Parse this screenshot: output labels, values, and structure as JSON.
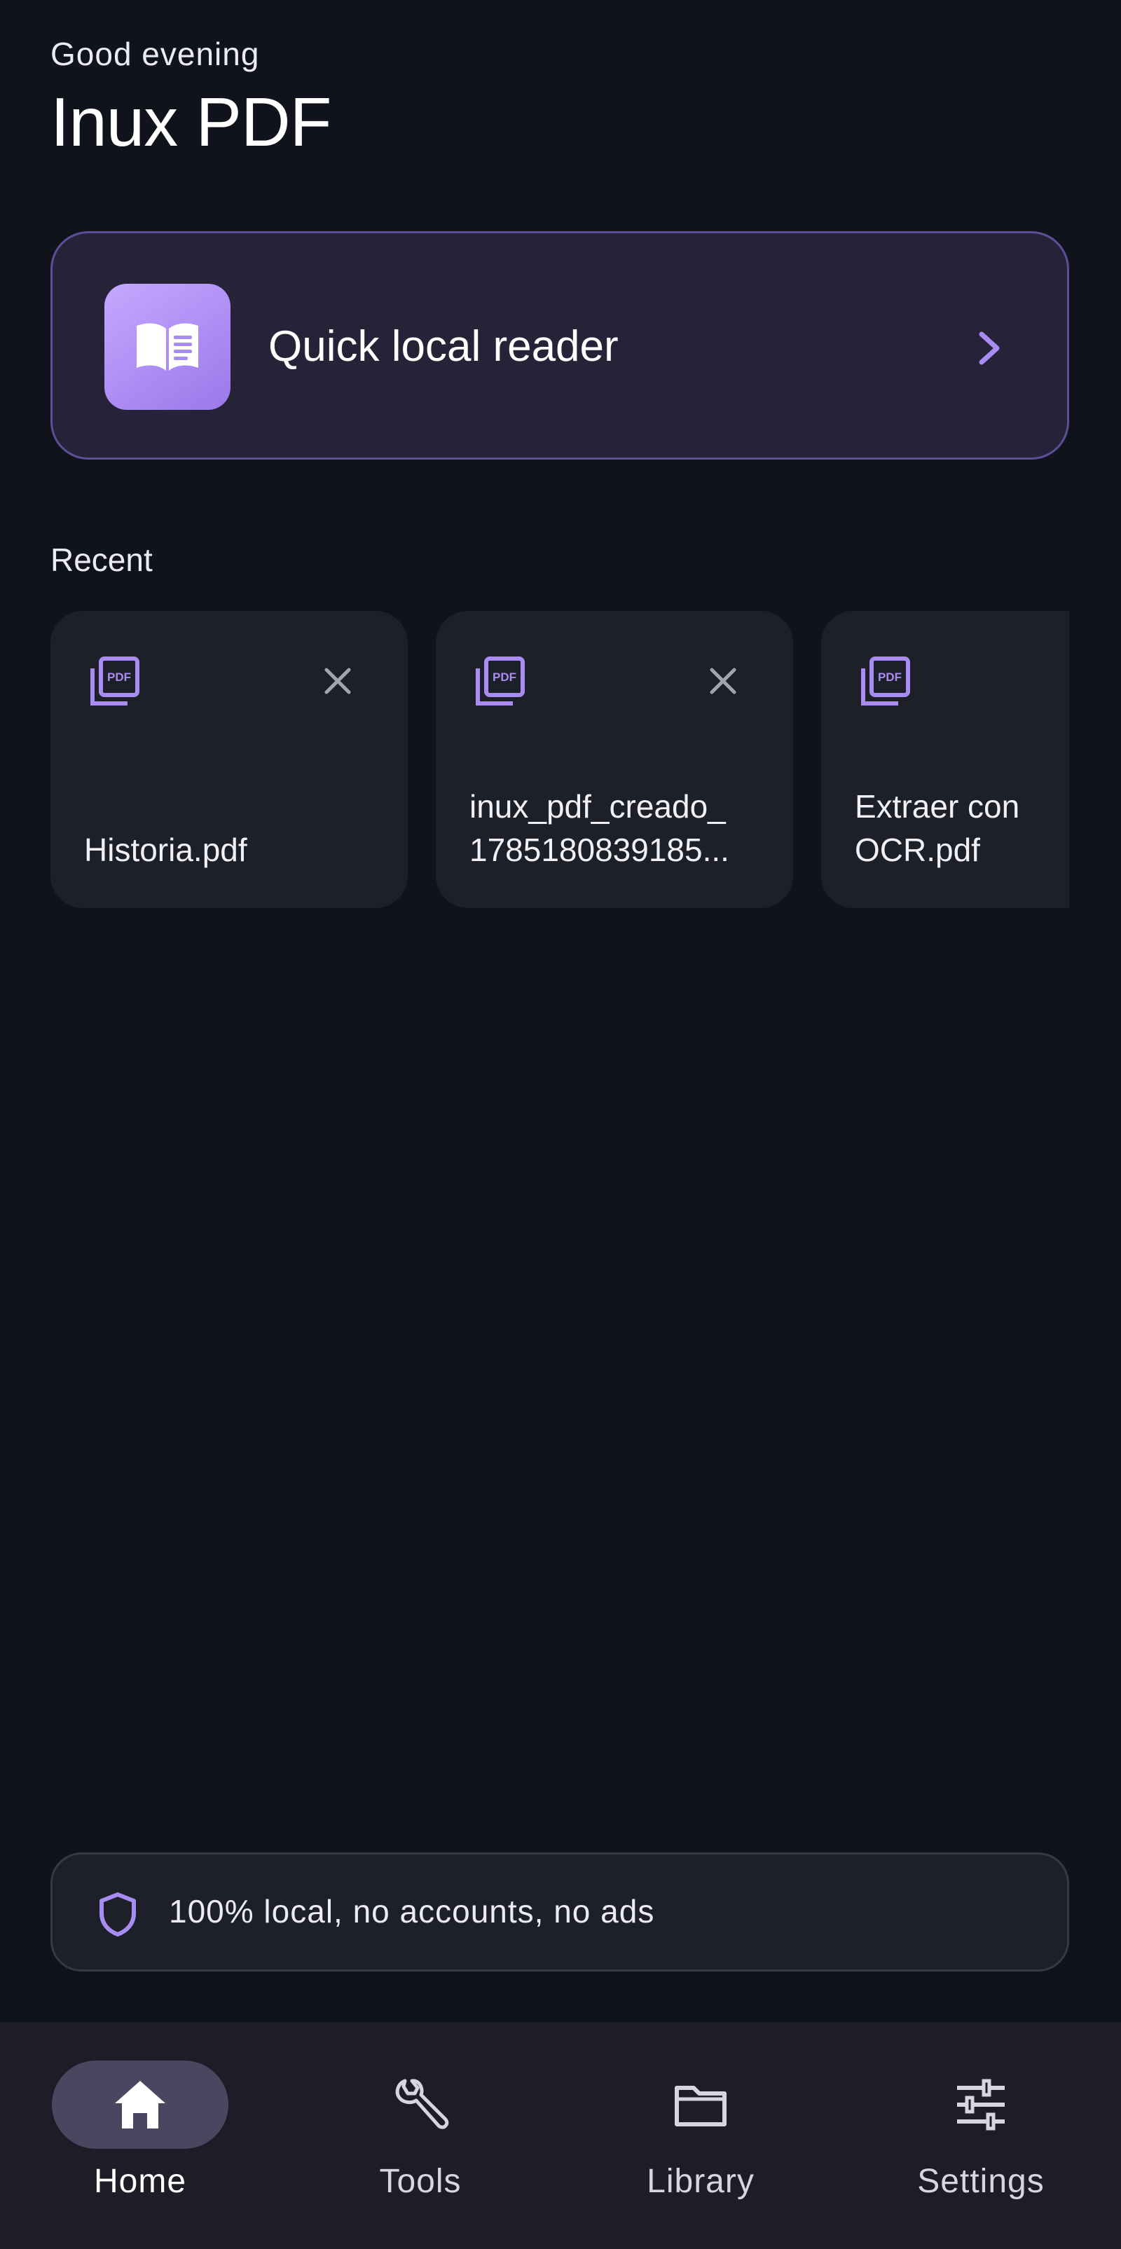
{
  "header": {
    "greeting": "Good evening",
    "title": "Inux PDF"
  },
  "quick_reader": {
    "label": "Quick local reader",
    "icon": "book-open-icon",
    "chevron_icon": "chevron-right-icon"
  },
  "recent": {
    "title": "Recent",
    "items": [
      {
        "name": "Historia.pdf",
        "icon": "pdf-file-icon",
        "removable": true
      },
      {
        "name": "inux_pdf_creado_\n1785180839185...",
        "icon": "pdf-file-icon",
        "removable": true
      },
      {
        "name": "Extraer con\nOCR.pdf",
        "icon": "pdf-file-icon",
        "removable": false
      }
    ]
  },
  "privacy": {
    "icon": "shield-icon",
    "text": "100% local, no accounts, no ads"
  },
  "nav": {
    "items": [
      {
        "label": "Home",
        "icon": "home-icon",
        "active": true
      },
      {
        "label": "Tools",
        "icon": "wrench-icon",
        "active": false
      },
      {
        "label": "Library",
        "icon": "folder-icon",
        "active": false
      },
      {
        "label": "Settings",
        "icon": "sliders-icon",
        "active": false
      }
    ]
  },
  "colors": {
    "background": "#10131b",
    "accent": "#a98cf2",
    "card": "#1e2029",
    "quick_card": "#262339",
    "quick_card_border": "#5d4e98",
    "nav_background": "#1d1d28",
    "nav_active_pill": "#494660"
  }
}
